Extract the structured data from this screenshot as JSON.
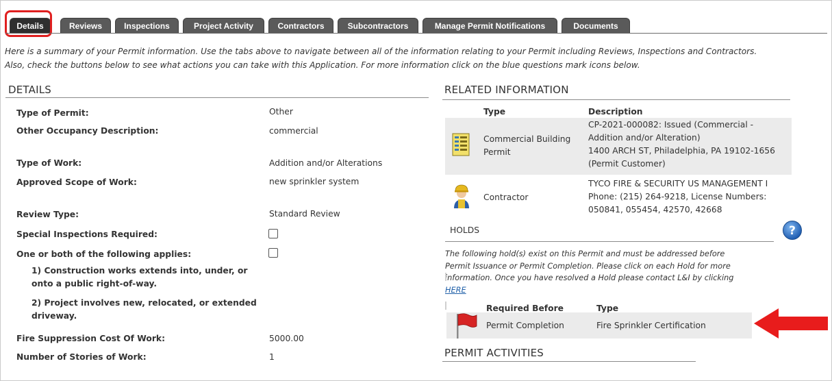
{
  "tabs": [
    {
      "label": "Details",
      "active": true
    },
    {
      "label": "Reviews"
    },
    {
      "label": "Inspections"
    },
    {
      "label": "Project Activity"
    },
    {
      "label": "Contractors"
    },
    {
      "label": "Subcontractors"
    },
    {
      "label": "Manage Permit Notifications"
    },
    {
      "label": "Documents"
    }
  ],
  "intro": {
    "line1": "Here is a summary of your Permit information. Use the tabs above to navigate between all of the information relating to your Permit including Reviews, Inspections and Contractors.",
    "line2": "Also, check the buttons below to see what actions you can take with this Application. For more information click on the blue questions mark icons below."
  },
  "details": {
    "title": "DETAILS",
    "fields": [
      {
        "label": "Type of Permit:",
        "value": "Other"
      },
      {
        "label": "Other Occupancy Description:",
        "value": "commercial"
      },
      {
        "label": "Type of Work:",
        "value": "Addition and/or Alterations"
      },
      {
        "label": "Approved Scope of Work:",
        "value": "new sprinkler system"
      },
      {
        "label": "Review Type:",
        "value": "Standard Review"
      },
      {
        "label": "Special Inspections Required:",
        "checked": false
      },
      {
        "label": "One or both of the following applies:",
        "checked": false
      },
      {
        "label": "Fire Suppression Cost Of Work:",
        "value": "5000.00"
      },
      {
        "label": "Number of Stories of Work:",
        "value": "1"
      }
    ],
    "subitems": {
      "item1a": "1) Construction works extends into, under, or",
      "item1b": "onto a public right-of-way.",
      "item2a": "2) Project involves new, relocated, or extended",
      "item2b": "driveway."
    }
  },
  "related": {
    "title": "RELATED INFORMATION",
    "col_type": "Type",
    "col_desc": "Description",
    "rows": [
      {
        "type_lines": [
          "Commercial Building",
          "Permit"
        ],
        "desc_lines": [
          "CP-2021-000082: Issued (Commercial -",
          "Addition and/or Alteration)",
          "1400 ARCH ST, Philadelphia, PA 19102-1656",
          "(Permit Customer)"
        ],
        "icon": "permit-document-icon"
      },
      {
        "type_lines": [
          "Contractor"
        ],
        "desc_lines": [
          "TYCO FIRE & SECURITY US MANAGEMENT I",
          "Phone: (215) 264-9218, License Numbers:",
          "050841, 055454, 42570, 42668"
        ],
        "icon": "contractor-worker-icon"
      }
    ]
  },
  "holds": {
    "title": "HOLDS",
    "text1": "The following hold(s) exist on this Permit and must be addressed before",
    "text2": "Permit Issuance or Permit Completion. Please click on each Hold for more",
    "text3": "information. Once you have resolved a Hold please contact L&I by clicking",
    "link": "HERE",
    "col_required": "Required Before",
    "col_type": "Type",
    "row": {
      "required_before": "Permit Completion",
      "type": "Fire Sprinkler Certification"
    }
  },
  "permit_activities": {
    "title": "PERMIT ACTIVITIES"
  },
  "colors": {
    "tab_bg": "#5a5a5a",
    "tab_active": "#2f2f2f",
    "highlight_red": "#e02020",
    "row_bg": "#ebebeb",
    "help_blue": "#2a6fc4",
    "link_blue": "#1f5fa8"
  }
}
